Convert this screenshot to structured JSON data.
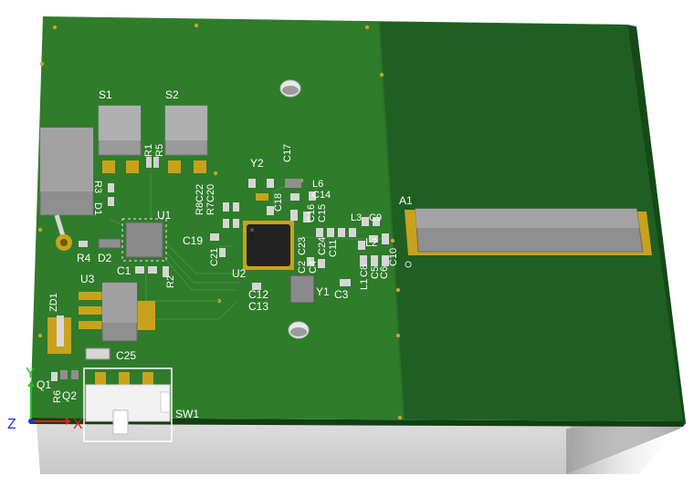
{
  "labels": {
    "S1": "S1",
    "S2": "S2",
    "R1": "R1",
    "R5": "R5",
    "Y2": "Y2",
    "C17": "C17",
    "L6": "L6",
    "C14": "C14",
    "C18": "C18",
    "C16": "C16",
    "C15": "C15",
    "L3": "L3",
    "C9": "C9",
    "R8": "R8",
    "R7": "R7",
    "C22": "C22",
    "C20": "C20",
    "C19": "C19",
    "U1": "U1",
    "R3": "R3",
    "D1": "D1",
    "R4": "R4",
    "D2": "D2",
    "C21": "C21",
    "C1": "C1",
    "R2": "R2",
    "U2": "U2",
    "C12": "C12",
    "C13": "C13",
    "C23": "C23",
    "C24": "C24",
    "C2": "C2",
    "C4": "C4",
    "C11": "C11",
    "L2": "L2",
    "L1": "L1",
    "C8": "C8",
    "C5": "C5",
    "C6": "C6",
    "C10": "C10",
    "C3": "C3",
    "Y1": "Y1",
    "A1": "A1",
    "U3": "U3",
    "C25": "C25",
    "ZD1": "ZD1",
    "Q1": "Q1",
    "R6": "R6",
    "Q2": "Q2",
    "SW1": "SW1"
  },
  "axes": {
    "x": "X",
    "y": "Y",
    "z": "Z"
  },
  "colors": {
    "board": "#2f7c2b",
    "board_dark": "#1f5f23",
    "board_edge": "#154918",
    "pad": "#c8a21c",
    "component": "#8f8f8f",
    "ic": "#2b2b2b",
    "axis_x": "#e02020",
    "axis_y": "#20c020",
    "axis_z": "#2030e0"
  }
}
